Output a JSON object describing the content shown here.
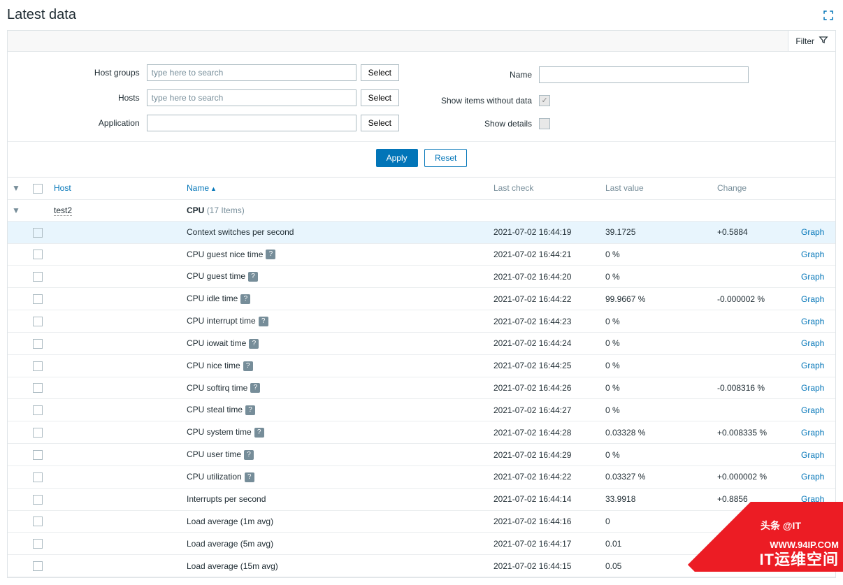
{
  "page": {
    "title": "Latest data",
    "filter_tab": "Filter"
  },
  "filter": {
    "labels": {
      "host_groups": "Host groups",
      "hosts": "Hosts",
      "application": "Application",
      "name": "Name",
      "show_items_without_data": "Show items without data",
      "show_details": "Show details"
    },
    "placeholders": {
      "host_groups": "type here to search",
      "hosts": "type here to search"
    },
    "buttons": {
      "select": "Select",
      "apply": "Apply",
      "reset": "Reset"
    },
    "show_items_without_data_checked": true,
    "show_details_checked": false
  },
  "table": {
    "headers": {
      "host": "Host",
      "name": "Name",
      "last_check": "Last check",
      "last_value": "Last value",
      "change": "Change"
    },
    "host": {
      "name": "test2"
    },
    "group": {
      "label": "CPU",
      "count_text": "(17 Items)"
    },
    "graph_label": "Graph",
    "items": [
      {
        "name": "Context switches per second",
        "help": false,
        "lastcheck": "2021-07-02 16:44:19",
        "lastvalue": "39.1725",
        "change": "+0.5884",
        "graph": true,
        "highlight": true
      },
      {
        "name": "CPU guest nice time",
        "help": true,
        "lastcheck": "2021-07-02 16:44:21",
        "lastvalue": "0 %",
        "change": "",
        "graph": true
      },
      {
        "name": "CPU guest time",
        "help": true,
        "lastcheck": "2021-07-02 16:44:20",
        "lastvalue": "0 %",
        "change": "",
        "graph": true
      },
      {
        "name": "CPU idle time",
        "help": true,
        "lastcheck": "2021-07-02 16:44:22",
        "lastvalue": "99.9667 %",
        "change": "-0.000002 %",
        "graph": true
      },
      {
        "name": "CPU interrupt time",
        "help": true,
        "lastcheck": "2021-07-02 16:44:23",
        "lastvalue": "0 %",
        "change": "",
        "graph": true
      },
      {
        "name": "CPU iowait time",
        "help": true,
        "lastcheck": "2021-07-02 16:44:24",
        "lastvalue": "0 %",
        "change": "",
        "graph": true
      },
      {
        "name": "CPU nice time",
        "help": true,
        "lastcheck": "2021-07-02 16:44:25",
        "lastvalue": "0 %",
        "change": "",
        "graph": true
      },
      {
        "name": "CPU softirq time",
        "help": true,
        "lastcheck": "2021-07-02 16:44:26",
        "lastvalue": "0 %",
        "change": "-0.008316 %",
        "graph": true
      },
      {
        "name": "CPU steal time",
        "help": true,
        "lastcheck": "2021-07-02 16:44:27",
        "lastvalue": "0 %",
        "change": "",
        "graph": true
      },
      {
        "name": "CPU system time",
        "help": true,
        "lastcheck": "2021-07-02 16:44:28",
        "lastvalue": "0.03328 %",
        "change": "+0.008335 %",
        "graph": true
      },
      {
        "name": "CPU user time",
        "help": true,
        "lastcheck": "2021-07-02 16:44:29",
        "lastvalue": "0 %",
        "change": "",
        "graph": true
      },
      {
        "name": "CPU utilization",
        "help": true,
        "lastcheck": "2021-07-02 16:44:22",
        "lastvalue": "0.03327 %",
        "change": "+0.000002 %",
        "graph": true
      },
      {
        "name": "Interrupts per second",
        "help": false,
        "lastcheck": "2021-07-02 16:44:14",
        "lastvalue": "33.9918",
        "change": "+0.8856",
        "graph": true
      },
      {
        "name": "Load average (1m avg)",
        "help": false,
        "lastcheck": "2021-07-02 16:44:16",
        "lastvalue": "0",
        "change": "",
        "graph": false
      },
      {
        "name": "Load average (5m avg)",
        "help": false,
        "lastcheck": "2021-07-02 16:44:17",
        "lastvalue": "0.01",
        "change": "",
        "graph": false
      },
      {
        "name": "Load average (15m avg)",
        "help": false,
        "lastcheck": "2021-07-02 16:44:15",
        "lastvalue": "0.05",
        "change": "",
        "graph": false
      }
    ]
  },
  "watermark": {
    "top": "头条 @IT",
    "url": "WWW.94IP.COM",
    "big": "IT运维空间"
  }
}
